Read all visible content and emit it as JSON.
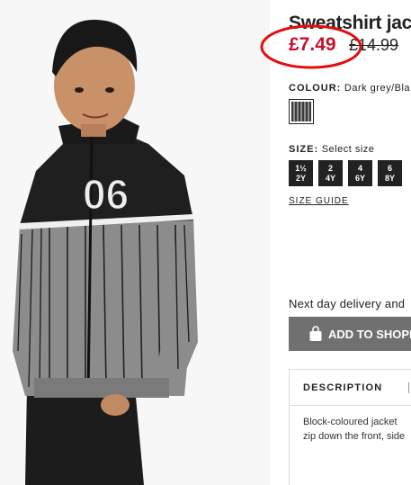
{
  "product": {
    "title": "Sweatshirt jac",
    "price_sale": "£7.49",
    "price_original": "£14.99"
  },
  "colour": {
    "label": "COLOUR:",
    "value": "Dark grey/Bla",
    "swatch_colors": [
      "#3a3a3a",
      "#8f8f8f"
    ]
  },
  "size": {
    "label": "SIZE:",
    "prompt": "Select size",
    "options": [
      {
        "top": "1½",
        "bottom": "2Y"
      },
      {
        "top": "2",
        "bottom": "4Y"
      },
      {
        "top": "4",
        "bottom": "6Y"
      },
      {
        "top": "6",
        "bottom": "8Y"
      }
    ],
    "guide_label": "SIZE GUIDE"
  },
  "delivery_text": "Next day delivery and",
  "add_button": {
    "label": "ADD TO SHOPP",
    "icon": "shopping-bag-icon"
  },
  "description": {
    "tab_label": "DESCRIPTION",
    "lines": [
      "Block-coloured jacket",
      "zip down the front, side"
    ]
  },
  "colors": {
    "sale_red": "#c8102e",
    "highlight_red": "#e01010",
    "button_grey": "#707070",
    "size_button_bg": "#222222"
  },
  "image": {
    "jacket_number": "06"
  }
}
